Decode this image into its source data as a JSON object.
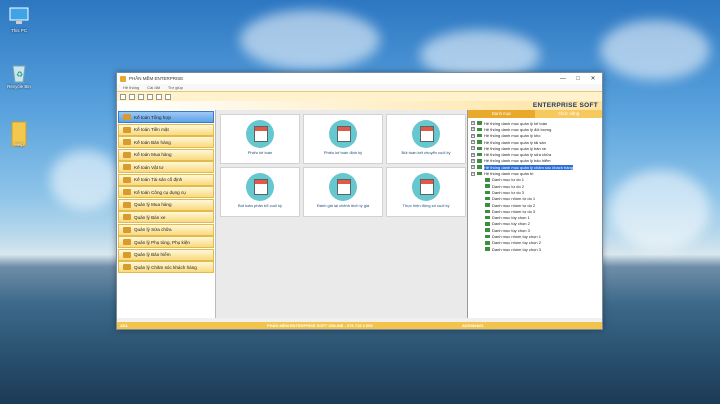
{
  "desktop": {
    "icons": [
      {
        "label": "This PC",
        "icon": "computer-icon"
      },
      {
        "label": "Recycle Bin",
        "icon": "recycle-bin-icon"
      },
      {
        "label": "Help",
        "icon": "folder-icon"
      }
    ]
  },
  "window": {
    "title": "PHẦN MỀM ENTERPRISE",
    "controls": {
      "minimize": "—",
      "maximize": "□",
      "close": "✕"
    }
  },
  "menu": [
    "Hệ thống",
    "Cài đặt",
    "Trợ giúp"
  ],
  "brand": "ENTERPRISE SOFT",
  "sidebar": [
    "Kế toán Tổng hợp",
    "Kế toán Tiền mặt",
    "Kế toán Bán hàng",
    "Kế toán Mua hàng",
    "Kế toán Vật tư",
    "Kế toán Tài sản cố định",
    "Kế toán Công cụ dụng cụ",
    "Quản lý Mua hàng",
    "Quản lý Bán xe",
    "Quản lý Sửa chữa",
    "Quản lý Phụ tùng, Phụ kiện",
    "Quản lý Bảo hiểm",
    "Quản lý Chăm sóc khách hàng"
  ],
  "tiles": [
    "Phiếu kế toán",
    "Phiếu kế toán định kỳ",
    "Bút toán kết chuyển cuối kỳ",
    "Bút toán phân bổ cuối kỳ",
    "Đánh giá lại chênh lệch tỷ giá",
    "Thực hiện động số cuối kỳ"
  ],
  "tabs": [
    "Danh mục",
    "Chức năng"
  ],
  "tree": [
    "Hệ thống danh mục quản lý kế toán",
    "Hệ thống danh mục quản lý đối tượng",
    "Hệ thống danh mục quản lý kho",
    "Hệ thống danh mục quản lý tài sản",
    "Hệ thống danh mục quản lý bán xe",
    "Hệ thống danh mục quản lý sửa chữa",
    "Hệ thống danh mục quản lý bảo hiểm",
    "Hệ thống danh mục quản lý chăm sóc khách hàng",
    "Hệ thống danh mục quản trị",
    "Danh mục tự do 1",
    "Danh mục tự do 2",
    "Danh mục tự do 3",
    "Danh mục nhóm tự do 1",
    "Danh mục nhóm tự do 2",
    "Danh mục nhóm tự do 3",
    "Danh mục tùy chọn 1",
    "Danh mục tùy chọn 2",
    "Danh mục tùy chọn 3",
    "Danh mục nhóm tùy chọn 1",
    "Danh mục nhóm tùy chọn 2",
    "Danh mục nhóm tùy chọn 3"
  ],
  "status": {
    "left": "ADL",
    "center": "PHẦN MỀM ENTERPRISE SOFT ONLINE - 076 719 2 009",
    "right": "ADGWeb01"
  }
}
